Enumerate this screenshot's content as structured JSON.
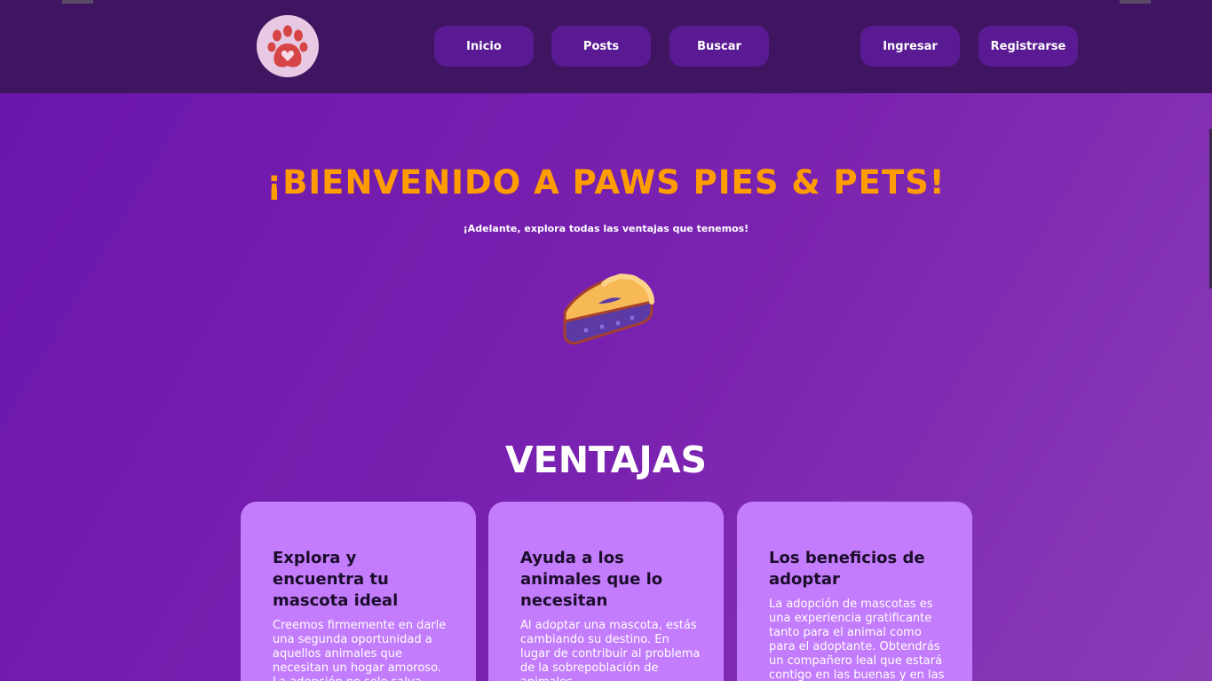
{
  "nav": {
    "inicio": "Inicio",
    "posts": "Posts",
    "buscar": "Buscar",
    "ingresar": "Ingresar",
    "registrarse": "Registrarse"
  },
  "hero": {
    "title": "¡BIENVENIDO A PAWS PIES & PETS!",
    "subtitle": "¡Adelante, explora todas las ventajas que tenemos!"
  },
  "ventajas": {
    "title": "VENTAJAS",
    "cards": [
      {
        "title": "Explora y encuentra tu mascota ideal",
        "text": "Creemos firmemente en darle una segunda oportunidad a aquellos animales que necesitan un hogar amoroso. La adopción no solo salva vidas, también enriquece la"
      },
      {
        "title": "Ayuda a los animales que lo necesitan",
        "text": "Al adoptar una mascota, estás cambiando su destino. En lugar de contribuir al problema de la sobrepoblación de animales"
      },
      {
        "title": "Los beneficios de adoptar",
        "text": "La adopción de mascotas es una experiencia gratificante tanto para el animal como para el adoptante. Obtendrás un compañero leal que estará contigo en las buenas y en las"
      }
    ]
  },
  "colors": {
    "navbar": "#3f1561",
    "nav_button": "#5a1a93",
    "accent": "#ff9d00",
    "card": "#c37cfb"
  },
  "icons": {
    "logo": "paw-heart-icon",
    "hero_image": "pie-slice-icon"
  }
}
